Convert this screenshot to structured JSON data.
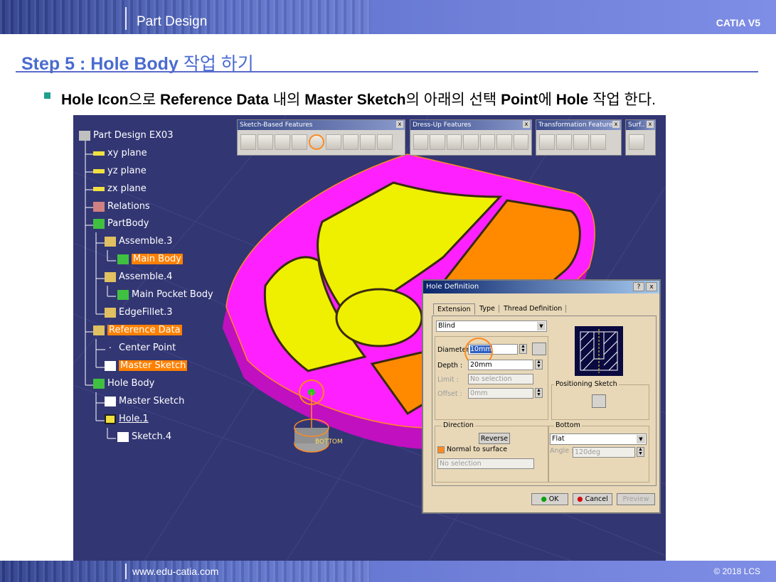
{
  "header": {
    "title": "Part Design",
    "brand": "CATIA V5"
  },
  "step": {
    "title_en": "Step 5 : Hole Body",
    "title_ko": "작업 하기"
  },
  "bullet": {
    "p1": "Hole Icon",
    "p2": "으로 ",
    "p3": "Reference Data",
    "p4": " 내의 ",
    "p5": "Master Sketch",
    "p6": "의 아래의 선택 ",
    "p7": "Point",
    "p8": "에 ",
    "p9": "Hole",
    "p10": " 작업 한다."
  },
  "tree": [
    {
      "label": "Part Design EX03",
      "icon": "part-icon"
    },
    {
      "label": "xy plane",
      "icon": "plane-icon"
    },
    {
      "label": "yz plane",
      "icon": "plane-icon"
    },
    {
      "label": "zx plane",
      "icon": "plane-icon"
    },
    {
      "label": "Relations",
      "icon": "relations-icon"
    },
    {
      "label": "PartBody",
      "icon": "body-icon"
    },
    {
      "label": "Assemble.3",
      "icon": "assemble-icon"
    },
    {
      "label": "Main Body",
      "icon": "body-icon"
    },
    {
      "label": "Assemble.4",
      "icon": "assemble-icon"
    },
    {
      "label": "Main Pocket Body",
      "icon": "body-icon"
    },
    {
      "label": "EdgeFillet.3",
      "icon": "fillet-icon"
    },
    {
      "label": "Reference Data",
      "icon": "geometrical-set-icon"
    },
    {
      "label": "Center Point",
      "icon": "point-icon"
    },
    {
      "label": "Master Sketch",
      "icon": "sketch-icon"
    },
    {
      "label": "Hole Body",
      "icon": "body-icon"
    },
    {
      "label": "Master Sketch",
      "icon": "sketch-icon"
    },
    {
      "label": "Hole.1",
      "icon": "hole-icon"
    },
    {
      "label": "Sketch.4",
      "icon": "sketch-icon"
    }
  ],
  "toolbars": [
    {
      "title": "Sketch-Based Features",
      "close": "x"
    },
    {
      "title": "Dress-Up Features",
      "close": "x"
    },
    {
      "title": "Transformation Features",
      "close": "x"
    },
    {
      "title": "Surf..",
      "close": "x"
    }
  ],
  "viewport": {
    "label": "BOTTOM"
  },
  "dialog": {
    "title": "Hole Definition",
    "help": "?",
    "close": "x",
    "tabs": [
      "Extension",
      "Type",
      "Thread Definition"
    ],
    "extension": "Blind",
    "diameter_label": "Diameter :",
    "diameter": "10mm",
    "depth_label": "Depth :",
    "depth": "20mm",
    "limit_label": "Limit :",
    "limit": "No selection",
    "offset_label": "Offset :",
    "offset": "0mm",
    "positioning_sketch": "Positioning Sketch",
    "direction_label": "Direction",
    "reverse": "Reverse",
    "normal_to_surface": "Normal to surface",
    "direction_selection": "No selection",
    "bottom_label": "Bottom",
    "bottom_value": "Flat",
    "angle_label": "Angle :",
    "angle": "120deg",
    "ok": "OK",
    "cancel": "Cancel",
    "preview": "Preview"
  },
  "footer": {
    "url": "www.edu-catia.com",
    "copyright": "© 2018 LCS"
  }
}
